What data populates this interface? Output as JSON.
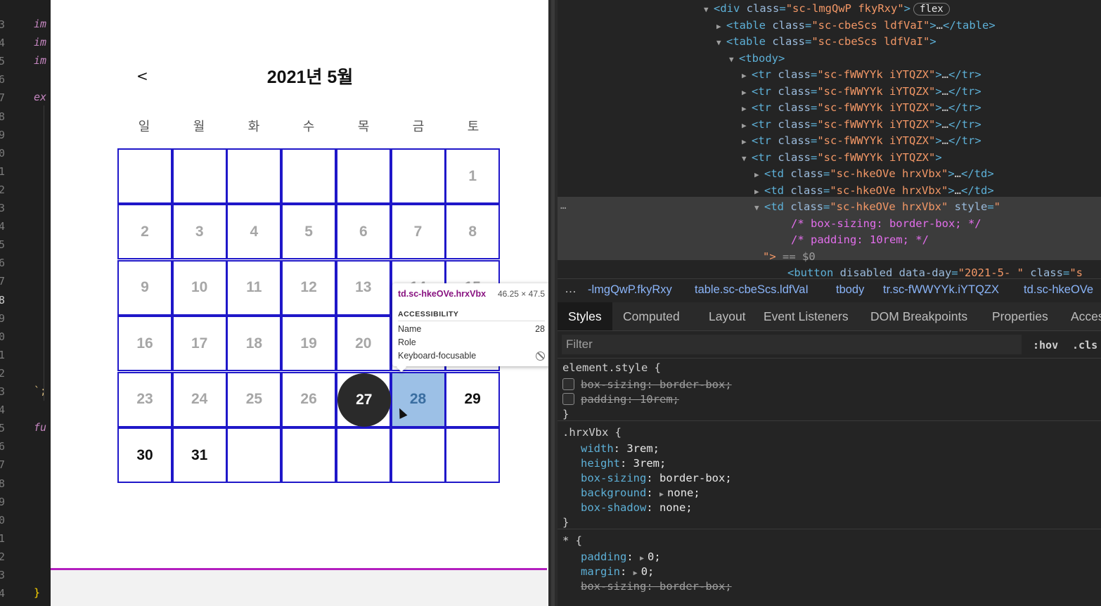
{
  "gutter": {
    "lines": [
      {
        "n": "3",
        "code": "im"
      },
      {
        "n": "4",
        "code": "im"
      },
      {
        "n": "5",
        "code": "im"
      },
      {
        "n": "6",
        "code": ""
      },
      {
        "n": "7",
        "code": "ex"
      },
      {
        "n": "8",
        "code": ""
      },
      {
        "n": "9",
        "code": ""
      },
      {
        "n": "0",
        "code": ""
      },
      {
        "n": "1",
        "code": ""
      },
      {
        "n": "2",
        "code": ""
      },
      {
        "n": "3",
        "code": ""
      },
      {
        "n": "4",
        "code": ""
      },
      {
        "n": "5",
        "code": ""
      },
      {
        "n": "6",
        "code": ""
      },
      {
        "n": "7",
        "code": ""
      },
      {
        "n": "8",
        "code": ""
      },
      {
        "n": "9",
        "code": ""
      },
      {
        "n": "0",
        "code": ""
      },
      {
        "n": "1",
        "code": ""
      },
      {
        "n": "2",
        "code": ""
      },
      {
        "n": "3",
        "code": "`;"
      },
      {
        "n": "4",
        "code": ""
      },
      {
        "n": "5",
        "code": "fu"
      },
      {
        "n": "6",
        "code": ""
      },
      {
        "n": "7",
        "code": ""
      },
      {
        "n": "8",
        "code": ""
      },
      {
        "n": "9",
        "code": ""
      },
      {
        "n": "0",
        "code": ""
      },
      {
        "n": "1",
        "code": ""
      },
      {
        "n": "2",
        "code": ""
      },
      {
        "n": "3",
        "code": ""
      },
      {
        "n": "4",
        "code": "}"
      }
    ]
  },
  "calendar": {
    "prev_label": "<",
    "title": "2021년 5월",
    "weekdays": [
      "일",
      "월",
      "화",
      "수",
      "목",
      "금",
      "토"
    ],
    "weeks": [
      [
        {
          "d": ""
        },
        {
          "d": ""
        },
        {
          "d": ""
        },
        {
          "d": ""
        },
        {
          "d": ""
        },
        {
          "d": ""
        },
        {
          "d": "1",
          "s": "dis"
        }
      ],
      [
        {
          "d": "2",
          "s": "dis"
        },
        {
          "d": "3",
          "s": "dis"
        },
        {
          "d": "4",
          "s": "dis"
        },
        {
          "d": "5",
          "s": "dis"
        },
        {
          "d": "6",
          "s": "dis"
        },
        {
          "d": "7",
          "s": "dis"
        },
        {
          "d": "8",
          "s": "dis"
        }
      ],
      [
        {
          "d": "9",
          "s": "dis"
        },
        {
          "d": "10",
          "s": "dis"
        },
        {
          "d": "11",
          "s": "dis"
        },
        {
          "d": "12",
          "s": "dis"
        },
        {
          "d": "13",
          "s": "dis"
        },
        {
          "d": "14",
          "s": "dis"
        },
        {
          "d": "15",
          "s": "dis"
        }
      ],
      [
        {
          "d": "16",
          "s": "dis"
        },
        {
          "d": "17",
          "s": "dis"
        },
        {
          "d": "18",
          "s": "dis"
        },
        {
          "d": "19",
          "s": "dis"
        },
        {
          "d": "20",
          "s": "dis"
        },
        {
          "d": "21",
          "s": "dis"
        },
        {
          "d": "22",
          "s": "dis"
        }
      ],
      [
        {
          "d": "23",
          "s": "dis"
        },
        {
          "d": "24",
          "s": "dis"
        },
        {
          "d": "25",
          "s": "dis"
        },
        {
          "d": "26",
          "s": "dis"
        },
        {
          "d": "27",
          "s": "today"
        },
        {
          "d": "28",
          "s": "sel"
        },
        {
          "d": "29",
          "s": "act"
        }
      ],
      [
        {
          "d": "30",
          "s": "act"
        },
        {
          "d": "31",
          "s": "act"
        },
        {
          "d": ""
        },
        {
          "d": ""
        },
        {
          "d": ""
        },
        {
          "d": ""
        },
        {
          "d": ""
        }
      ]
    ],
    "colors": {
      "border": "#1f17c9",
      "selected_bg": "#9cc0e6",
      "today_bg": "#2a2a2a",
      "divider": "#b31fbf"
    }
  },
  "tooltip": {
    "selector": "td.sc-hkeOVe.hrxVbx",
    "size": "46.25 × 47.5",
    "section": "ACCESSIBILITY",
    "name_label": "Name",
    "name_value": "28",
    "role_label": "Role",
    "focus_label": "Keyboard-focusable",
    "focus_icon": "not-allowed-icon"
  },
  "elements_tree": {
    "lines": [
      {
        "tri": "▼",
        "parts": [
          [
            "tg",
            "<div "
          ],
          [
            "an",
            "class"
          ],
          [
            "tg",
            "="
          ],
          [
            "av",
            "\"sc-lmgQwP fkyRxy\""
          ],
          [
            "tg",
            ">"
          ]
        ],
        "badge": "flex"
      },
      {
        "tri": "▶",
        "parts": [
          [
            "tg",
            "<table "
          ],
          [
            "an",
            "class"
          ],
          [
            "tg",
            "="
          ],
          [
            "av",
            "\"sc-cbeScs ldfVaI\""
          ],
          [
            "tg",
            ">"
          ],
          [
            "wt",
            "…"
          ],
          [
            "tg",
            "</table>"
          ]
        ]
      },
      {
        "tri": "▼",
        "parts": [
          [
            "tg",
            "<table "
          ],
          [
            "an",
            "class"
          ],
          [
            "tg",
            "="
          ],
          [
            "av",
            "\"sc-cbeScs ldfVaI\""
          ],
          [
            "tg",
            ">"
          ]
        ]
      },
      {
        "tri": "▼",
        "parts": [
          [
            "tg",
            "<tbody>"
          ]
        ]
      },
      {
        "tri": "▶",
        "parts": [
          [
            "tg",
            "<tr "
          ],
          [
            "an",
            "class"
          ],
          [
            "tg",
            "="
          ],
          [
            "av",
            "\"sc-fWWYYk iYTQZX\""
          ],
          [
            "tg",
            ">"
          ],
          [
            "wt",
            "…"
          ],
          [
            "tg",
            "</tr>"
          ]
        ]
      },
      {
        "tri": "▶",
        "parts": [
          [
            "tg",
            "<tr "
          ],
          [
            "an",
            "class"
          ],
          [
            "tg",
            "="
          ],
          [
            "av",
            "\"sc-fWWYYk iYTQZX\""
          ],
          [
            "tg",
            ">"
          ],
          [
            "wt",
            "…"
          ],
          [
            "tg",
            "</tr>"
          ]
        ]
      },
      {
        "tri": "▶",
        "parts": [
          [
            "tg",
            "<tr "
          ],
          [
            "an",
            "class"
          ],
          [
            "tg",
            "="
          ],
          [
            "av",
            "\"sc-fWWYYk iYTQZX\""
          ],
          [
            "tg",
            ">"
          ],
          [
            "wt",
            "…"
          ],
          [
            "tg",
            "</tr>"
          ]
        ]
      },
      {
        "tri": "▶",
        "parts": [
          [
            "tg",
            "<tr "
          ],
          [
            "an",
            "class"
          ],
          [
            "tg",
            "="
          ],
          [
            "av",
            "\"sc-fWWYYk iYTQZX\""
          ],
          [
            "tg",
            ">"
          ],
          [
            "wt",
            "…"
          ],
          [
            "tg",
            "</tr>"
          ]
        ]
      },
      {
        "tri": "▶",
        "parts": [
          [
            "tg",
            "<tr "
          ],
          [
            "an",
            "class"
          ],
          [
            "tg",
            "="
          ],
          [
            "av",
            "\"sc-fWWYYk iYTQZX\""
          ],
          [
            "tg",
            ">"
          ],
          [
            "wt",
            "…"
          ],
          [
            "tg",
            "</tr>"
          ]
        ]
      },
      {
        "tri": "▼",
        "parts": [
          [
            "tg",
            "<tr "
          ],
          [
            "an",
            "class"
          ],
          [
            "tg",
            "="
          ],
          [
            "av",
            "\"sc-fWWYYk iYTQZX\""
          ],
          [
            "tg",
            ">"
          ]
        ]
      },
      {
        "tri": "▶",
        "parts": [
          [
            "tg",
            "<td "
          ],
          [
            "an",
            "class"
          ],
          [
            "tg",
            "="
          ],
          [
            "av",
            "\"sc-hkeOVe hrxVbx\""
          ],
          [
            "tg",
            ">"
          ],
          [
            "wt",
            "…"
          ],
          [
            "tg",
            "</td>"
          ]
        ]
      },
      {
        "tri": "▶",
        "parts": [
          [
            "tg",
            "<td "
          ],
          [
            "an",
            "class"
          ],
          [
            "tg",
            "="
          ],
          [
            "av",
            "\"sc-hkeOVe hrxVbx\""
          ],
          [
            "tg",
            ">"
          ],
          [
            "wt",
            "…"
          ],
          [
            "tg",
            "</td>"
          ]
        ]
      },
      {
        "tri": "▼",
        "parts": [
          [
            "tg",
            "<td "
          ],
          [
            "an",
            "class"
          ],
          [
            "tg",
            "="
          ],
          [
            "av",
            "\"sc-hkeOVe hrxVbx\" "
          ],
          [
            "an",
            "style"
          ],
          [
            "tg",
            "="
          ],
          [
            "av",
            "\""
          ]
        ]
      },
      {
        "tri": "",
        "parts": [
          [
            "cm",
            "/* box-sizing: border-box; */"
          ]
        ]
      },
      {
        "tri": "",
        "parts": [
          [
            "cm",
            "/* padding: 10rem; */"
          ]
        ]
      },
      {
        "tri": "",
        "parts": [
          [
            "av",
            "\">"
          ],
          [
            "gr",
            " == $0"
          ]
        ]
      },
      {
        "tri": "",
        "parts": [
          [
            "tg",
            "<button "
          ],
          [
            "an",
            "disabled data-day"
          ],
          [
            "tg",
            "="
          ],
          [
            "av",
            "\"2021-5- \" "
          ],
          [
            "an",
            "class"
          ],
          [
            "tg",
            "="
          ],
          [
            "av",
            "\"s"
          ]
        ]
      }
    ],
    "dots": "…"
  },
  "breadcrumbs": {
    "more": "…",
    "items": [
      {
        "tag": "",
        "cls": "-lmgQwP.fkyRxy"
      },
      {
        "tag": "table",
        "cls": ".sc-cbeScs.ldfVaI"
      },
      {
        "tag": "tbody",
        "cls": ""
      },
      {
        "tag": "tr",
        "cls": ".sc-fWWYYk.iYTQZX"
      },
      {
        "tag": "td",
        "cls": ".sc-hkeOVe"
      }
    ]
  },
  "tabs": [
    "Styles",
    "Computed",
    "Layout",
    "Event Listeners",
    "DOM Breakpoints",
    "Properties",
    "Acces"
  ],
  "filter": {
    "placeholder": "Filter",
    "hov": ":hov",
    "cls": ".cls"
  },
  "rules": {
    "element_style": {
      "selector": "element.style {",
      "props": [
        {
          "n": "box-sizing",
          "v": "border-box"
        },
        {
          "n": "padding",
          "v": "10rem"
        }
      ],
      "close": "}"
    },
    "hrxVbx": {
      "selector": ".hrxVbx {",
      "props": [
        {
          "n": "width",
          "v": "3rem"
        },
        {
          "n": "height",
          "v": "3rem"
        },
        {
          "n": "box-sizing",
          "v": "border-box"
        },
        {
          "n": "background",
          "v": "none"
        },
        {
          "n": "box-shadow",
          "v": "none"
        }
      ],
      "close": "}"
    },
    "star": {
      "selector": "* {",
      "props": [
        {
          "n": "padding",
          "v": "0"
        },
        {
          "n": "margin",
          "v": "0"
        },
        {
          "n": "box-sizing",
          "v": "border-box"
        }
      ]
    }
  }
}
